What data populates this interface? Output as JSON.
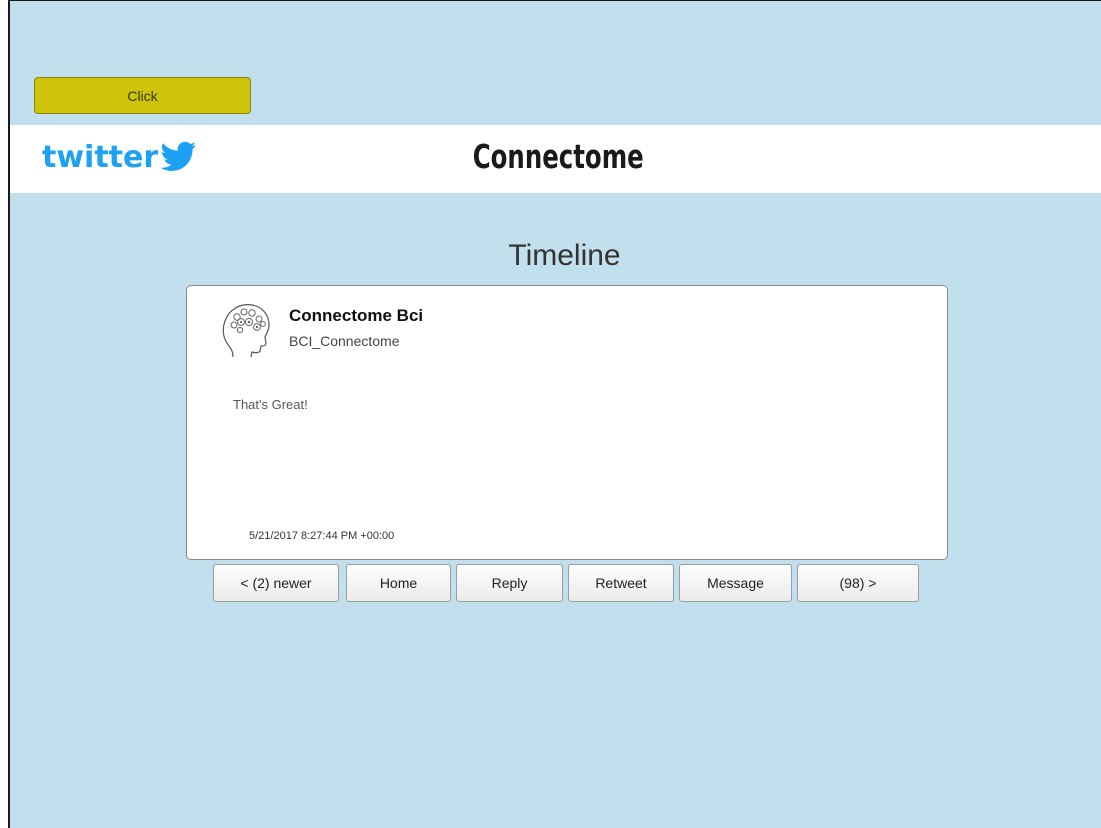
{
  "top_button": {
    "label": "Click",
    "color": "#cdc30a"
  },
  "header": {
    "brand_logo": "twitter",
    "brand_icon": "twitter-bird-icon",
    "brand_color": "#1da1f2",
    "app_title": "Connectome"
  },
  "page": {
    "heading": "Timeline",
    "background": "#c2dfee"
  },
  "tweet": {
    "avatar_icon": "head-gears-icon",
    "display_name": "Connectome Bci",
    "handle": "BCI_Connectome",
    "text": "That's Great!",
    "timestamp": "5/21/2017 8:27:44 PM +00:00"
  },
  "nav_buttons": [
    {
      "label": "< (2) newer"
    },
    {
      "label": "Home"
    },
    {
      "label": "Reply"
    },
    {
      "label": "Retweet"
    },
    {
      "label": "Message"
    },
    {
      "label": "(98) >"
    }
  ]
}
